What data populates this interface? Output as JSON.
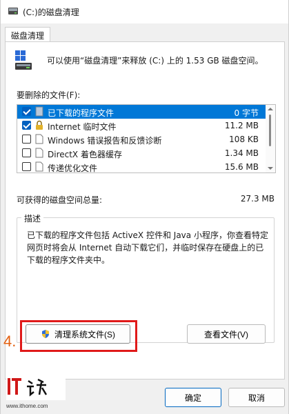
{
  "window": {
    "title": "(C:)的磁盘清理"
  },
  "tabs": [
    {
      "label": "磁盘清理"
    }
  ],
  "summary": {
    "text": "可以使用“磁盘清理”来释放  (C:) 上的 1.53 GB 磁盘空间。"
  },
  "file_list": {
    "label": "要删除的文件(F):",
    "items": [
      {
        "name": "已下载的程序文件",
        "size": "0 字节",
        "checked": true,
        "selected": true,
        "icon": "folder-icon"
      },
      {
        "name": "Internet 临时文件",
        "size": "11.2 MB",
        "checked": true,
        "selected": false,
        "icon": "lock-icon"
      },
      {
        "name": "Windows 错误报告和反馈诊断",
        "size": "108 KB",
        "checked": false,
        "selected": false,
        "icon": "file-icon"
      },
      {
        "name": "DirectX 着色器缓存",
        "size": "1.34 MB",
        "checked": false,
        "selected": false,
        "icon": "file-icon"
      },
      {
        "name": "传递优化文件",
        "size": "15.6 MB",
        "checked": false,
        "selected": false,
        "icon": "file-icon"
      }
    ]
  },
  "total": {
    "label": "可获得的磁盘空间总量:",
    "value": "27.3 MB"
  },
  "description": {
    "legend": "描述",
    "text": "已下载的程序文件包括 ActiveX 控件和 Java 小程序，你查看特定网页时将会从 Internet 自动下载它们，并临时保存在硬盘上的已下载的程序文件夹中。"
  },
  "buttons": {
    "clean_system": "清理系统文件(S)",
    "view_files": "查看文件(V)",
    "ok": "确定",
    "cancel": "取消"
  },
  "annotation": {
    "step": "4."
  },
  "watermark": {
    "logo_text": "IT之家",
    "url": "www.ithome.com"
  },
  "colors": {
    "selection": "#0078d7",
    "highlight": "#e01919",
    "step": "#e46010"
  }
}
